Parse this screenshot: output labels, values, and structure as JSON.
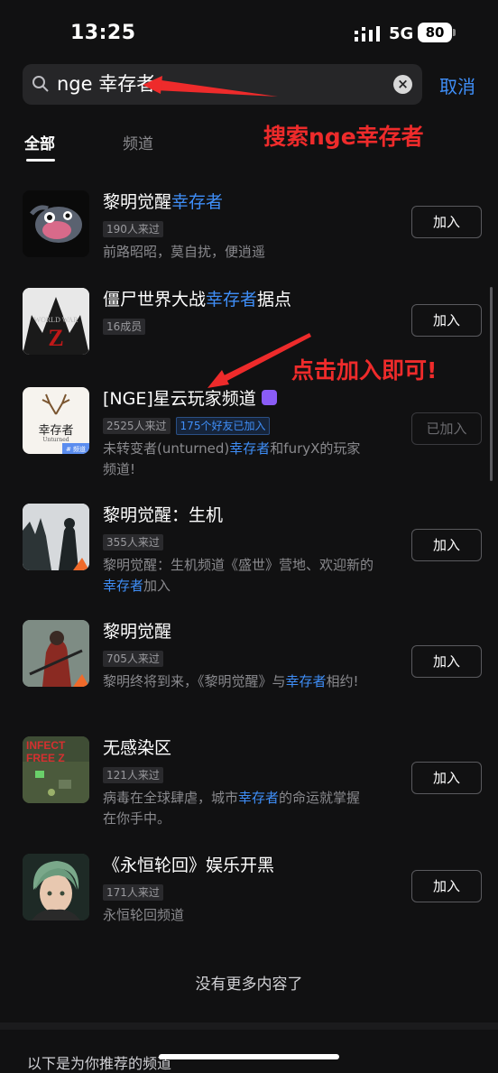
{
  "status": {
    "time": "13:25",
    "network": "5G",
    "battery": "80"
  },
  "search": {
    "query": "nge 幸存者",
    "cancel": "取消"
  },
  "tabs": [
    {
      "label": "全部"
    },
    {
      "label": "频道"
    }
  ],
  "annotations": {
    "search_note": "搜索nge幸存者",
    "join_note": "点击加入即可!"
  },
  "results": [
    {
      "title": "黎明觉醒",
      "title_hl": "幸存者",
      "title_rest": "",
      "tags": [
        "190人来过"
      ],
      "friend_tag": "",
      "desc": "前路昭昭，莫自扰，便逍遥",
      "desc_hl": "",
      "desc_rest": "",
      "button": "加入",
      "joined": false
    },
    {
      "title": "僵尸世界大战",
      "title_hl": "幸存者",
      "title_rest": "据点",
      "tags": [
        "16成员"
      ],
      "friend_tag": "",
      "desc": "",
      "desc_hl": "",
      "desc_rest": "",
      "button": "加入",
      "joined": false
    },
    {
      "title": "[NGE]星云玩家频道",
      "title_hl": "",
      "title_rest": "",
      "tags": [
        "2525人来过"
      ],
      "friend_tag": "175个好友已加入",
      "desc": "未转变者(unturned)",
      "desc_hl": "幸存者",
      "desc_rest": "和furyX的玩家频道!",
      "button": "已加入",
      "joined": true
    },
    {
      "title": "黎明觉醒：生机",
      "title_hl": "",
      "title_rest": "",
      "tags": [
        "355人来过"
      ],
      "friend_tag": "",
      "desc": "黎明觉醒：生机频道《盛世》营地、欢迎新的",
      "desc_hl": "幸存者",
      "desc_rest": "加入",
      "button": "加入",
      "joined": false
    },
    {
      "title": "黎明觉醒",
      "title_hl": "",
      "title_rest": "",
      "tags": [
        "705人来过"
      ],
      "friend_tag": "",
      "desc": "黎明终将到来，《黎明觉醒》与",
      "desc_hl": "幸存者",
      "desc_rest": "相约!",
      "button": "加入",
      "joined": false
    },
    {
      "title": "无感染区",
      "title_hl": "",
      "title_rest": "",
      "tags": [
        "121人来过"
      ],
      "friend_tag": "",
      "desc": "病毒在全球肆虐，城市",
      "desc_hl": "幸存者",
      "desc_rest": "的命运就掌握在你手中。",
      "button": "加入",
      "joined": false
    },
    {
      "title": "《永恒轮回》娱乐开黑",
      "title_hl": "",
      "title_rest": "",
      "tags": [
        "171人来过"
      ],
      "friend_tag": "",
      "desc": "永恒轮回频道",
      "desc_hl": "",
      "desc_rest": "",
      "button": "加入",
      "joined": false
    }
  ],
  "avatar_texts": {
    "ww_top": "WORLD WAR",
    "ww_letter": "Z",
    "nge_name": "幸存者",
    "nge_sub": "Unturned",
    "nge_badge": "# 频道",
    "infect_1": "INFECT",
    "infect_2": "FREE Z"
  },
  "footer": {
    "no_more": "没有更多内容了",
    "recommend": "以下是为你推荐的频道"
  }
}
